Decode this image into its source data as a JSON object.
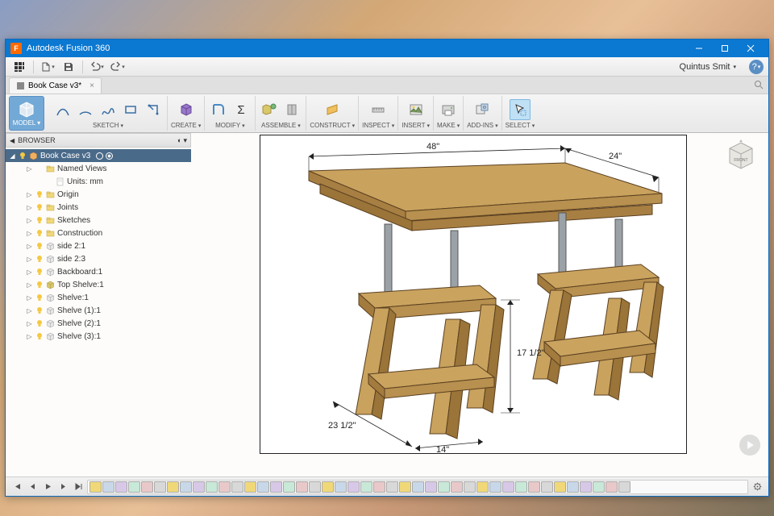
{
  "app": {
    "title": "Autodesk Fusion 360",
    "icon_letter": "F"
  },
  "quickbar": {
    "user": "Quintus Smit"
  },
  "tabs": [
    {
      "label": "Book Case v3*"
    }
  ],
  "ribbon": {
    "model_label": "MODEL",
    "groups": [
      {
        "name": "SKETCH",
        "icons": [
          "line",
          "arc",
          "spline",
          "rect",
          "circle"
        ]
      },
      {
        "name": "CREATE",
        "icons": [
          "extrude"
        ]
      },
      {
        "name": "MODIFY",
        "icons": [
          "fillet",
          "sigma"
        ]
      },
      {
        "name": "ASSEMBLE",
        "icons": [
          "asm1",
          "asm2"
        ]
      },
      {
        "name": "CONSTRUCT",
        "icons": [
          "plane"
        ]
      },
      {
        "name": "INSPECT",
        "icons": [
          "measure"
        ]
      },
      {
        "name": "INSERT",
        "icons": [
          "image"
        ]
      },
      {
        "name": "MAKE",
        "icons": [
          "print"
        ]
      },
      {
        "name": "ADD-INS",
        "icons": [
          "addins"
        ]
      },
      {
        "name": "SELECT",
        "icons": [
          "select"
        ],
        "active": true
      }
    ]
  },
  "browser": {
    "title": "BROWSER",
    "root": "Book Case v3",
    "items": [
      {
        "indent": 1,
        "twist": "▷",
        "bulb": null,
        "icon": "folder",
        "label": "Named Views"
      },
      {
        "indent": 2,
        "twist": "",
        "bulb": null,
        "icon": "doc",
        "label": "Units: mm"
      },
      {
        "indent": 1,
        "twist": "▷",
        "bulb": "on",
        "icon": "folder",
        "label": "Origin"
      },
      {
        "indent": 1,
        "twist": "▷",
        "bulb": "on",
        "icon": "folder",
        "label": "Joints"
      },
      {
        "indent": 1,
        "twist": "▷",
        "bulb": "on",
        "icon": "folder",
        "label": "Sketches"
      },
      {
        "indent": 1,
        "twist": "▷",
        "bulb": "on",
        "icon": "folder",
        "label": "Construction"
      },
      {
        "indent": 1,
        "twist": "▷",
        "bulb": "on",
        "icon": "comp",
        "label": "side 2:1"
      },
      {
        "indent": 1,
        "twist": "▷",
        "bulb": "on",
        "icon": "comp",
        "label": "side 2:3"
      },
      {
        "indent": 1,
        "twist": "▷",
        "bulb": "on",
        "icon": "comp",
        "label": "Backboard:1"
      },
      {
        "indent": 1,
        "twist": "▷",
        "bulb": "on",
        "icon": "compg",
        "label": "Top Shelve:1"
      },
      {
        "indent": 1,
        "twist": "▷",
        "bulb": "on",
        "icon": "comp",
        "label": "Shelve:1"
      },
      {
        "indent": 1,
        "twist": "▷",
        "bulb": "on",
        "icon": "comp",
        "label": "Shelve (1):1"
      },
      {
        "indent": 1,
        "twist": "▷",
        "bulb": "on",
        "icon": "comp",
        "label": "Shelve (2):1"
      },
      {
        "indent": 1,
        "twist": "▷",
        "bulb": "on",
        "icon": "comp",
        "label": "Shelve (3):1"
      }
    ]
  },
  "dimensions": {
    "width": "48\"",
    "depth": "24\"",
    "height": "17 1/2\"",
    "leg_depth": "23 1/2\"",
    "leg_width": "14\""
  },
  "timeline": {
    "count": 42
  }
}
